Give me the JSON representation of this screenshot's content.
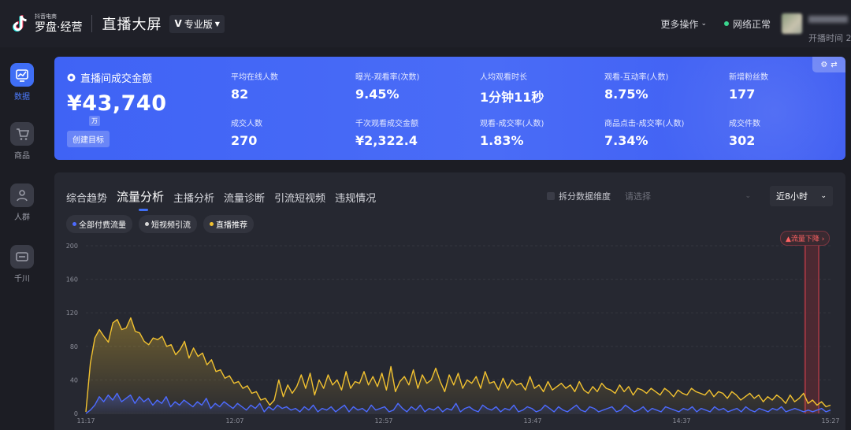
{
  "header": {
    "logo_small": "抖音电商",
    "logo_big": "罗盘·经营",
    "title": "直播大屏",
    "edition": "专业版",
    "more_ops": "更多操作",
    "net_status": "网络正常",
    "live_time": "开播时间 2"
  },
  "sidebar": {
    "items": [
      {
        "label": "数据",
        "icon": "trend-icon",
        "active": true
      },
      {
        "label": "商品",
        "icon": "cart-icon",
        "active": false
      },
      {
        "label": "人群",
        "icon": "people-icon",
        "active": false
      },
      {
        "label": "千川",
        "icon": "qianchuan-icon",
        "active": false
      }
    ]
  },
  "stats": {
    "gmv_title": "直播间成交金额",
    "gmv_value": "¥43,740",
    "gmv_unit": "万",
    "create_goal": "创建目标",
    "metrics": [
      {
        "label": "平均在线人数",
        "value": "82"
      },
      {
        "label": "曝光-观看率(次数)",
        "value": "9.45%"
      },
      {
        "label": "人均观看时长",
        "value": "1分钟11秒"
      },
      {
        "label": "观看-互动率(人数)",
        "value": "8.75%"
      },
      {
        "label": "新增粉丝数",
        "value": "177"
      },
      {
        "label": "成交人数",
        "value": "270"
      },
      {
        "label": "千次观看成交金额",
        "value": "¥2,322.4"
      },
      {
        "label": "观看-成交率(人数)",
        "value": "1.83%"
      },
      {
        "label": "商品点击-成交率(人数)",
        "value": "7.34%"
      },
      {
        "label": "成交件数",
        "value": "302"
      }
    ]
  },
  "panel": {
    "tabs": [
      "综合趋势",
      "流量分析",
      "主播分析",
      "流量诊断",
      "引流短视频",
      "违规情况"
    ],
    "active_tab": 1,
    "dim_label": "拆分数据维度",
    "dim_placeholder": "请选择",
    "range": "近8小时",
    "legend": [
      {
        "name": "全部付费流量",
        "color": "#4d6bff"
      },
      {
        "name": "短视频引流",
        "color": "#d8d8d8"
      },
      {
        "name": "直播推荐",
        "color": "#f2c230"
      }
    ],
    "alert": "流量下降"
  },
  "chart_data": {
    "type": "area",
    "x_ticks": [
      "11:17",
      "12:07",
      "12:57",
      "13:47",
      "14:37",
      "15:27"
    ],
    "y_ticks": [
      0,
      40,
      80,
      120,
      160,
      200
    ],
    "ylim": [
      0,
      200
    ],
    "grid": true,
    "series": [
      {
        "name": "直播推荐",
        "color": "#f2c230",
        "values": [
          2,
          60,
          90,
          100,
          92,
          85,
          108,
          112,
          100,
          102,
          114,
          98,
          96,
          86,
          82,
          90,
          88,
          92,
          80,
          82,
          70,
          76,
          86,
          66,
          78,
          68,
          72,
          58,
          64,
          50,
          52,
          42,
          45,
          36,
          38,
          30,
          33,
          24,
          26,
          16,
          18,
          10,
          16,
          40,
          20,
          34,
          24,
          32,
          46,
          30,
          48,
          22,
          40,
          30,
          46,
          34,
          40,
          28,
          50,
          30,
          38,
          36,
          50,
          34,
          44,
          32,
          48,
          28,
          56,
          26,
          38,
          44,
          34,
          52,
          30,
          46,
          36,
          40,
          54,
          38,
          26,
          46,
          34,
          48,
          30,
          40,
          36,
          44,
          30,
          50,
          36,
          38,
          28,
          42,
          30,
          40,
          34,
          36,
          28,
          44,
          30,
          34,
          26,
          38,
          28,
          32,
          36,
          30,
          34,
          26,
          38,
          28,
          24,
          32,
          26,
          36,
          30,
          28,
          24,
          34,
          26,
          32,
          22,
          30,
          28,
          24,
          30,
          26,
          22,
          30,
          26,
          20,
          28,
          24,
          22,
          30,
          26,
          24,
          22,
          28,
          20,
          26,
          24,
          18,
          26,
          22,
          16,
          20,
          24,
          18,
          22,
          14,
          20,
          16,
          22,
          18,
          12,
          22,
          14,
          18,
          24,
          12,
          16,
          10,
          14,
          8,
          10
        ],
        "note": "approximate, read from chart"
      },
      {
        "name": "全部付费流量",
        "color": "#4d6bff",
        "values": [
          0,
          4,
          10,
          20,
          14,
          22,
          16,
          24,
          14,
          18,
          22,
          12,
          20,
          14,
          18,
          10,
          16,
          12,
          20,
          8,
          14,
          10,
          16,
          12,
          8,
          14,
          10,
          18,
          6,
          12,
          8,
          14,
          10,
          6,
          12,
          8,
          4,
          10,
          6,
          12,
          2,
          8,
          4,
          10,
          6,
          8,
          4,
          6,
          2,
          8,
          4,
          10,
          2,
          6,
          4,
          8,
          2,
          6,
          10,
          2,
          8,
          4,
          6,
          2,
          10,
          4,
          6,
          8,
          2,
          4,
          12,
          6,
          2,
          8,
          4,
          10,
          2,
          6,
          4,
          8,
          2,
          6,
          4,
          12,
          2,
          6,
          8,
          4,
          2,
          10,
          6,
          4,
          8,
          2,
          6,
          4,
          10,
          2,
          4,
          8,
          6,
          2,
          4,
          10,
          6,
          2,
          8,
          4,
          2,
          6,
          10,
          4,
          2,
          8,
          6,
          2,
          4,
          6,
          8,
          2,
          4,
          10,
          6,
          2,
          4,
          8,
          2,
          6,
          4,
          2,
          8,
          6,
          4,
          2,
          6,
          4,
          8,
          2,
          6,
          4,
          2,
          8,
          4,
          6,
          2,
          4,
          6,
          2,
          8,
          4,
          2,
          6,
          4,
          2,
          6,
          4,
          8,
          2,
          4,
          6,
          4,
          2,
          4,
          2,
          4,
          6,
          2,
          4
        ],
        "note": "approximate, read from chart"
      }
    ]
  }
}
